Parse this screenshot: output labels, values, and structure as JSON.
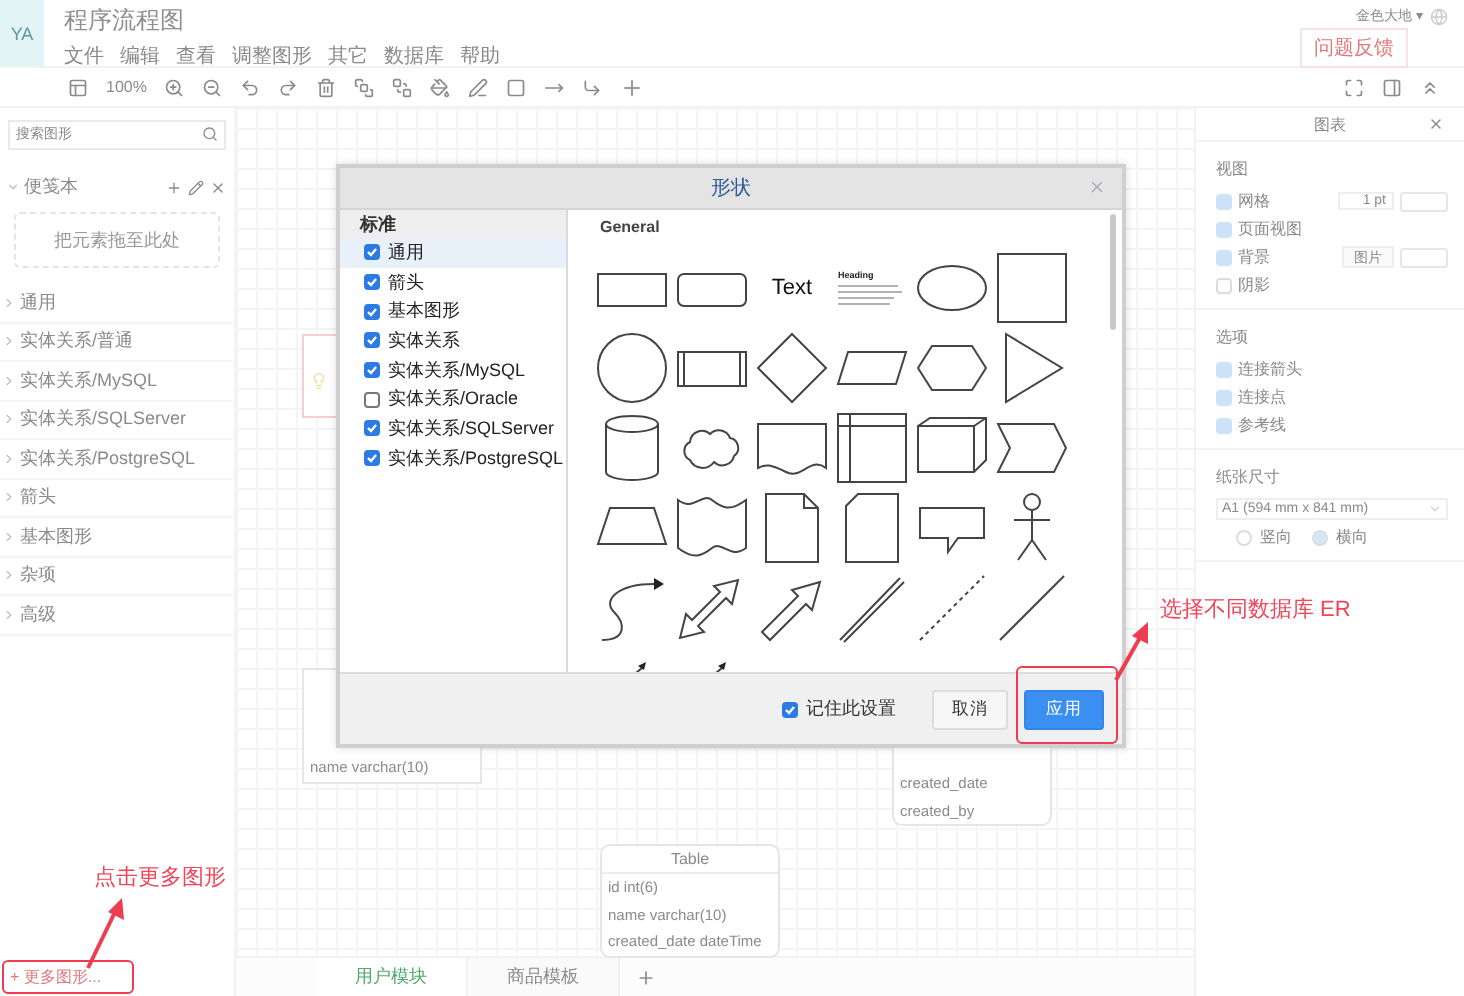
{
  "header": {
    "avatar": "YA",
    "title": "程序流程图",
    "menu": [
      "文件",
      "编辑",
      "查看",
      "调整图形",
      "其它",
      "数据库",
      "帮助"
    ],
    "user": "金色大地 ▾",
    "feedback_button": "问题反馈"
  },
  "toolbar": {
    "zoom": "100%"
  },
  "sidebar": {
    "search": {
      "placeholder": "搜索图形"
    },
    "scratchpad": {
      "title": "便笺本",
      "drop_hint": "把元素拖至此处"
    },
    "items": [
      "通用",
      "实体关系/普通",
      "实体关系/MySQL",
      "实体关系/SQLServer",
      "实体关系/PostgreSQL",
      "箭头",
      "基本图形",
      "杂项",
      "高级"
    ],
    "more_button": "+ 更多图形..."
  },
  "canvas": {
    "tables": [
      {
        "kind": "hidden"
      },
      {
        "kind": "partial",
        "rows": [
          "name varchar(10)"
        ]
      },
      {
        "kind": "partial",
        "rows": [
          "created_date",
          "created_by"
        ]
      },
      {
        "kind": "full",
        "title": "Table",
        "rows": [
          "id int(6)",
          "name varchar(10)",
          "created_date dateTime"
        ]
      }
    ]
  },
  "page_tabs": [
    {
      "label": "用户模块",
      "selected": true
    },
    {
      "label": "商品模板",
      "selected": false
    }
  ],
  "format_panel": {
    "title": "图表",
    "sections": [
      {
        "title": "视图",
        "options": [
          {
            "label": "网格",
            "checked": true,
            "kind": "spinner",
            "value": "1 pt"
          },
          {
            "label": "页面视图",
            "checked": true,
            "kind": "plain"
          },
          {
            "label": "背景",
            "checked": true,
            "kind": "image",
            "button": "图片"
          },
          {
            "label": "阴影",
            "checked": false,
            "kind": "plain"
          }
        ]
      },
      {
        "title": "选项",
        "options": [
          {
            "label": "连接箭头",
            "checked": true,
            "kind": "plain"
          },
          {
            "label": "连接点",
            "checked": true,
            "kind": "plain"
          },
          {
            "label": "参考线",
            "checked": true,
            "kind": "plain"
          }
        ]
      }
    ],
    "paper": {
      "title": "纸张尺寸",
      "size": "A1 (594 mm x 841 mm)",
      "orientations": [
        {
          "label": "竖向",
          "selected": false
        },
        {
          "label": "横向",
          "selected": true
        }
      ]
    }
  },
  "dialog": {
    "title": "形状",
    "list_header": "标准",
    "libraries": [
      {
        "label": "通用",
        "checked": true,
        "selected": true
      },
      {
        "label": "箭头",
        "checked": true,
        "selected": false
      },
      {
        "label": "基本图形",
        "checked": true,
        "selected": false
      },
      {
        "label": "实体关系",
        "checked": true,
        "selected": false
      },
      {
        "label": "实体关系/MySQL",
        "checked": true,
        "selected": false
      },
      {
        "label": "实体关系/Oracle",
        "checked": false,
        "selected": false
      },
      {
        "label": "实体关系/SQLServer",
        "checked": true,
        "selected": false
      },
      {
        "label": "实体关系/PostgreSQL",
        "checked": true,
        "selected": false
      }
    ],
    "section_title": "General",
    "shapes": [
      {
        "kind": "rect"
      },
      {
        "kind": "rounded"
      },
      {
        "kind": "text",
        "label": "Text"
      },
      {
        "kind": "heading",
        "label": "Heading"
      },
      {
        "kind": "ellipse"
      },
      {
        "kind": "square"
      },
      {
        "kind": "circle"
      },
      {
        "kind": "process"
      },
      {
        "kind": "diamond"
      },
      {
        "kind": "parallelogram"
      },
      {
        "kind": "hexagon"
      },
      {
        "kind": "triangle"
      },
      {
        "kind": "cylinder"
      },
      {
        "kind": "cloud"
      },
      {
        "kind": "document"
      },
      {
        "kind": "storage"
      },
      {
        "kind": "cube"
      },
      {
        "kind": "step"
      },
      {
        "kind": "trapezoid"
      },
      {
        "kind": "tape"
      },
      {
        "kind": "note"
      },
      {
        "kind": "card"
      },
      {
        "kind": "callout"
      },
      {
        "kind": "actor"
      },
      {
        "kind": "curve"
      },
      {
        "kind": "bidir"
      },
      {
        "kind": "arrow"
      },
      {
        "kind": "double"
      },
      {
        "kind": "dashed"
      },
      {
        "kind": "line"
      },
      {
        "kind": "connector"
      },
      {
        "kind": "connector"
      }
    ],
    "remember": {
      "label": "记住此设置",
      "checked": true
    },
    "cancel_button": "取消",
    "apply_button": "应用"
  },
  "annotations": [
    {
      "kind": "left",
      "text": "点击更多图形"
    },
    {
      "kind": "right",
      "text": "选择不同数据库 ER"
    }
  ]
}
